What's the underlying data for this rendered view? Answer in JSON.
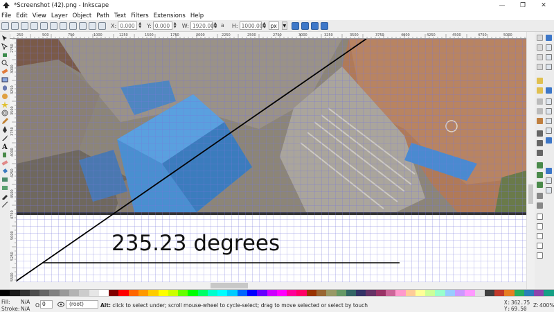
{
  "window": {
    "title": "*Screenshot (42).png - Inkscape",
    "minimize": "—",
    "maximize": "❐",
    "close": "✕"
  },
  "menu": [
    "File",
    "Edit",
    "View",
    "Layer",
    "Object",
    "Path",
    "Text",
    "Filters",
    "Extensions",
    "Help"
  ],
  "toolbar": {
    "x_label": "X:",
    "x_value": "0.000",
    "y_label": "Y:",
    "y_value": "0.000",
    "w_label": "W:",
    "w_value": "1920.000",
    "h_label": "H:",
    "h_value": "1000.000",
    "units": "px"
  },
  "ruler": {
    "h_ticks": [
      "250",
      "500",
      "750",
      "1000",
      "1250",
      "1500",
      "1750",
      "2000",
      "2250",
      "2500",
      "2750",
      "3000",
      "3250",
      "3500",
      "3750",
      "4000",
      "4250",
      "4500",
      "4750",
      "5000"
    ],
    "v_ticks": [
      "2750",
      "3000",
      "3250",
      "3500",
      "3750",
      "4000",
      "4250",
      "4500",
      "4750",
      "5000",
      "5250",
      "5500"
    ]
  },
  "canvas": {
    "angle_text": "235.23 degrees"
  },
  "status": {
    "fill_label": "Fill:",
    "fill_value": "N/A",
    "stroke_label": "Stroke:",
    "stroke_value": "N/A",
    "opacity_label": "O:",
    "opacity_value": "0",
    "layer_value": "(root)",
    "message_bold": "Alt:",
    "message": " click to select under; scroll mouse-wheel to cycle-select; drag to move selected or select by touch",
    "x_label": "X:",
    "x_value": "362.75",
    "y_label": "Y:",
    "y_value": "69.50",
    "zoom_label": "Z:",
    "zoom_value": "400%"
  },
  "palette": [
    "#000000",
    "#1a1a1a",
    "#333333",
    "#4d4d4d",
    "#666666",
    "#808080",
    "#999999",
    "#b3b3b3",
    "#cccccc",
    "#e6e6e6",
    "#ffffff",
    "#800000",
    "#ff0000",
    "#ff6600",
    "#ff9900",
    "#ffcc00",
    "#ffff00",
    "#ccff00",
    "#66ff00",
    "#00ff00",
    "#00ff66",
    "#00ffcc",
    "#00ffff",
    "#00ccff",
    "#0066ff",
    "#0000ff",
    "#6600ff",
    "#cc00ff",
    "#ff00ff",
    "#ff0099",
    "#ff0066",
    "#993300",
    "#996633",
    "#999966",
    "#669966",
    "#336666",
    "#333366",
    "#663366",
    "#993366",
    "#cc6699",
    "#ff99cc",
    "#ffcc99",
    "#ffff99",
    "#ccff99",
    "#99ffcc",
    "#99ccff",
    "#cc99ff",
    "#ff99ff",
    "#e0e0e0",
    "#404040",
    "#c0392b",
    "#e67e22",
    "#27ae60",
    "#2980b9",
    "#8e44ad",
    "#16a085"
  ]
}
